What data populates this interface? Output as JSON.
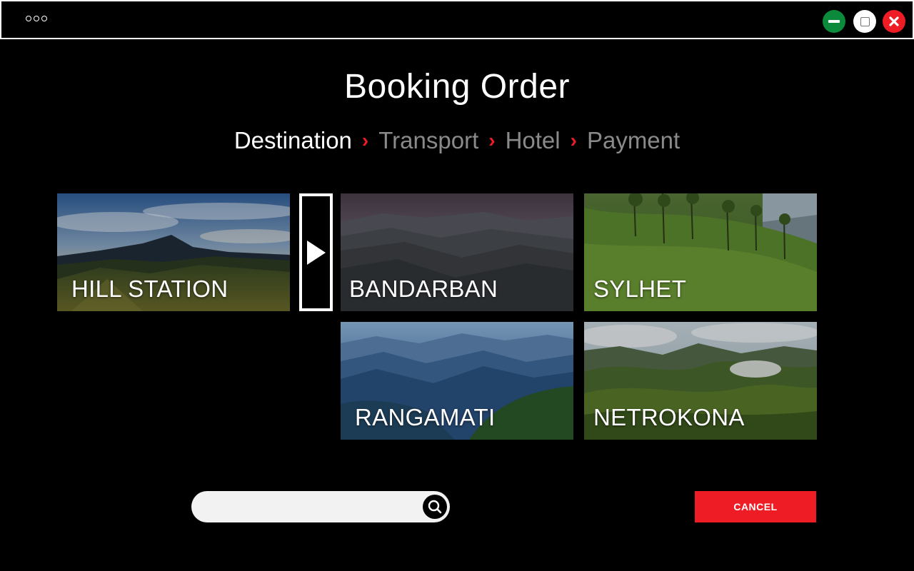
{
  "window": {
    "menu_icon": "more-dots-icon",
    "minimize_icon": "minimize-icon",
    "maximize_icon": "maximize-icon",
    "close_icon": "close-icon",
    "colors": {
      "minimize": "#0a8a3a",
      "maximize": "#ffffff",
      "close": "#ee1c24"
    }
  },
  "page": {
    "title": "Booking Order"
  },
  "steps": {
    "items": [
      {
        "label": "Destination",
        "active": true
      },
      {
        "label": "Transport",
        "active": false
      },
      {
        "label": "Hotel",
        "active": false
      },
      {
        "label": "Payment",
        "active": false
      }
    ],
    "separator_icon": "chevron-right-icon",
    "accent_color": "#ee1c24"
  },
  "category": {
    "label": "HILL STATION",
    "next_icon": "play-arrow-icon"
  },
  "destinations": [
    {
      "label": "BANDARBAN"
    },
    {
      "label": "SYLHET"
    },
    {
      "label": "RANGAMATI"
    },
    {
      "label": "NETROKONA"
    }
  ],
  "search": {
    "value": "",
    "placeholder": "",
    "icon": "search-icon"
  },
  "actions": {
    "cancel_label": "CANCEL",
    "cancel_color": "#ee1c24"
  }
}
